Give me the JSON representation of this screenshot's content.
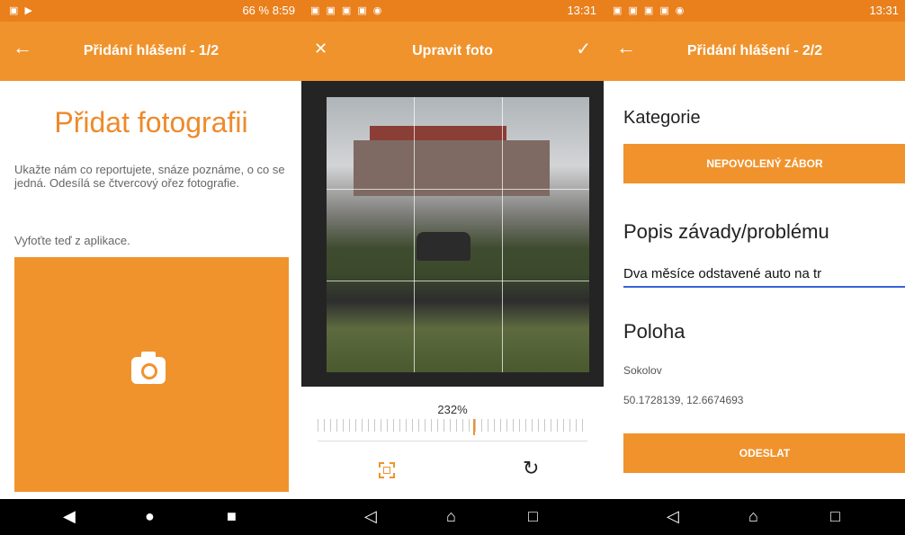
{
  "colors": {
    "accent": "#f0932c",
    "statusbar": "#e9801c",
    "navbar": "#000000"
  },
  "screen1": {
    "status_right": "66 % 8:59",
    "title": "Přidání hlášení - 1/2",
    "back_icon": "arrow-left-icon",
    "heading": "Přidat fotografii",
    "description": "Ukažte nám co reportujete, snáze poznáme, o co se jedná. Odesílá se čtvercový ořez fotografie.",
    "hint": "Vyfoťte teď z aplikace.",
    "camera_icon": "camera-icon"
  },
  "screen2": {
    "status_right": "13:31",
    "title": "Upravit foto",
    "close_icon": "close-icon",
    "confirm_icon": "check-icon",
    "zoom": "232%",
    "crop_icon": "crop-icon",
    "rotate_icon": "rotate-icon"
  },
  "screen3": {
    "status_right": "13:31",
    "title": "Přidání hlášení - 2/2",
    "back_icon": "arrow-left-icon",
    "category_label": "Kategorie",
    "category_value": "NEPOVOLENÝ ZÁBOR",
    "description_label": "Popis závady/problému",
    "description_value": "Dva měsíce odstavené auto na tr",
    "location_label": "Poloha",
    "location_city": "Sokolov",
    "location_coords": "50.1728139, 12.6674693",
    "submit_label": "ODESLAT"
  },
  "navigation": {
    "black_back": "◀",
    "black_home": "●",
    "black_recent": "■",
    "outline_back": "◁",
    "outline_home": "⌂",
    "outline_recent": "□"
  }
}
